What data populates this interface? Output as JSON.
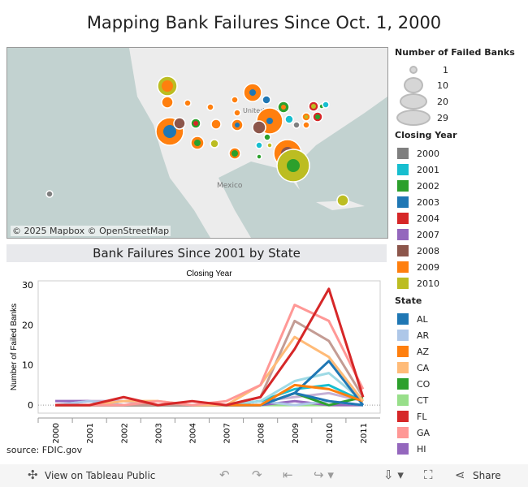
{
  "title": "Mapping Bank Failures Since Oct. 1, 2000",
  "map": {
    "credit": "© 2025 Mapbox © OpenStreetMap",
    "labels": [
      "United States",
      "Mexico"
    ]
  },
  "size_legend": {
    "title": "Number of Failed Banks",
    "items": [
      "1",
      "10",
      "20",
      "29"
    ]
  },
  "year_legend": {
    "title": "Closing Year",
    "items": [
      {
        "label": "2000",
        "color": "#7f7f7f"
      },
      {
        "label": "2001",
        "color": "#17becf"
      },
      {
        "label": "2002",
        "color": "#2ca02c"
      },
      {
        "label": "2003",
        "color": "#1f77b4"
      },
      {
        "label": "2004",
        "color": "#d62728"
      },
      {
        "label": "2007",
        "color": "#9467bd"
      },
      {
        "label": "2008",
        "color": "#8c564b"
      },
      {
        "label": "2009",
        "color": "#ff7f0e"
      },
      {
        "label": "2010",
        "color": "#bcbd22"
      }
    ]
  },
  "state_legend": {
    "title": "State",
    "items": [
      {
        "label": "AL",
        "color": "#1f77b4"
      },
      {
        "label": "AR",
        "color": "#aec7e8"
      },
      {
        "label": "AZ",
        "color": "#ff7f0e"
      },
      {
        "label": "CA",
        "color": "#ffbb78"
      },
      {
        "label": "CO",
        "color": "#2ca02c"
      },
      {
        "label": "CT",
        "color": "#98df8a"
      },
      {
        "label": "FL",
        "color": "#d62728"
      },
      {
        "label": "GA",
        "color": "#ff9896"
      },
      {
        "label": "HI",
        "color": "#9467bd"
      }
    ]
  },
  "chart_header": "Bank Failures Since 2001 by State",
  "chart_data": {
    "type": "line",
    "title": "Closing Year",
    "ylabel": "Number of Failed Banks",
    "ylim": [
      -2,
      31
    ],
    "yticks": [
      0,
      10,
      20,
      30
    ],
    "categories": [
      "2000",
      "2001",
      "2002",
      "2003",
      "2004",
      "2007",
      "2008",
      "2009",
      "2010",
      "2011"
    ],
    "series": [
      {
        "color": "#98df8a",
        "values": [
          0,
          0,
          0,
          0,
          0,
          0,
          0,
          0,
          0,
          0
        ]
      },
      {
        "name": "HI",
        "color": "#9467bd",
        "values": [
          1,
          1,
          0,
          0,
          0,
          0,
          0,
          1,
          0,
          0
        ]
      },
      {
        "color": "#c5b0d5",
        "values": [
          0,
          1,
          1,
          0,
          0,
          0,
          1,
          2,
          3,
          1
        ]
      },
      {
        "name": "AR",
        "color": "#aec7e8",
        "values": [
          0,
          1,
          0,
          0,
          0,
          0,
          1,
          0,
          1,
          0
        ]
      },
      {
        "name": "CO",
        "color": "#2ca02c",
        "values": [
          0,
          0,
          0,
          0,
          0,
          0,
          0,
          3,
          0,
          2
        ]
      },
      {
        "color": "#17becf",
        "values": [
          0,
          0,
          0,
          0,
          0,
          0,
          1,
          4,
          5,
          1
        ]
      },
      {
        "color": "#9edae5",
        "values": [
          0,
          0,
          0,
          0,
          0,
          0,
          1,
          6,
          8,
          1
        ]
      },
      {
        "color": "#1f77b4",
        "values": [
          0,
          0,
          0,
          0,
          0,
          0,
          0,
          3,
          11,
          0
        ]
      },
      {
        "name": "AL",
        "color": "#1f77b4",
        "values": [
          0,
          0,
          0,
          0,
          0,
          0,
          0,
          3,
          1,
          0
        ]
      },
      {
        "name": "AZ",
        "color": "#ff7f0e",
        "values": [
          0,
          0,
          0,
          0,
          0,
          0,
          0,
          5,
          4,
          1
        ]
      },
      {
        "color": "#c49c94",
        "values": [
          0,
          0,
          0,
          0,
          0,
          0,
          2,
          21,
          16,
          2
        ]
      },
      {
        "name": "CA",
        "color": "#ffbb78",
        "values": [
          0,
          0,
          1,
          1,
          0,
          0,
          5,
          17,
          12,
          1
        ]
      },
      {
        "name": "GA",
        "color": "#ff9896",
        "values": [
          0,
          0,
          0,
          1,
          0,
          1,
          5,
          25,
          21,
          4
        ]
      },
      {
        "name": "FL",
        "color": "#d62728",
        "values": [
          0,
          0,
          2,
          0,
          1,
          0,
          2,
          14,
          29,
          2
        ]
      }
    ]
  },
  "source": "source: FDIC.gov",
  "toolbar": {
    "view": "View on Tableau Public",
    "share": "Share"
  }
}
